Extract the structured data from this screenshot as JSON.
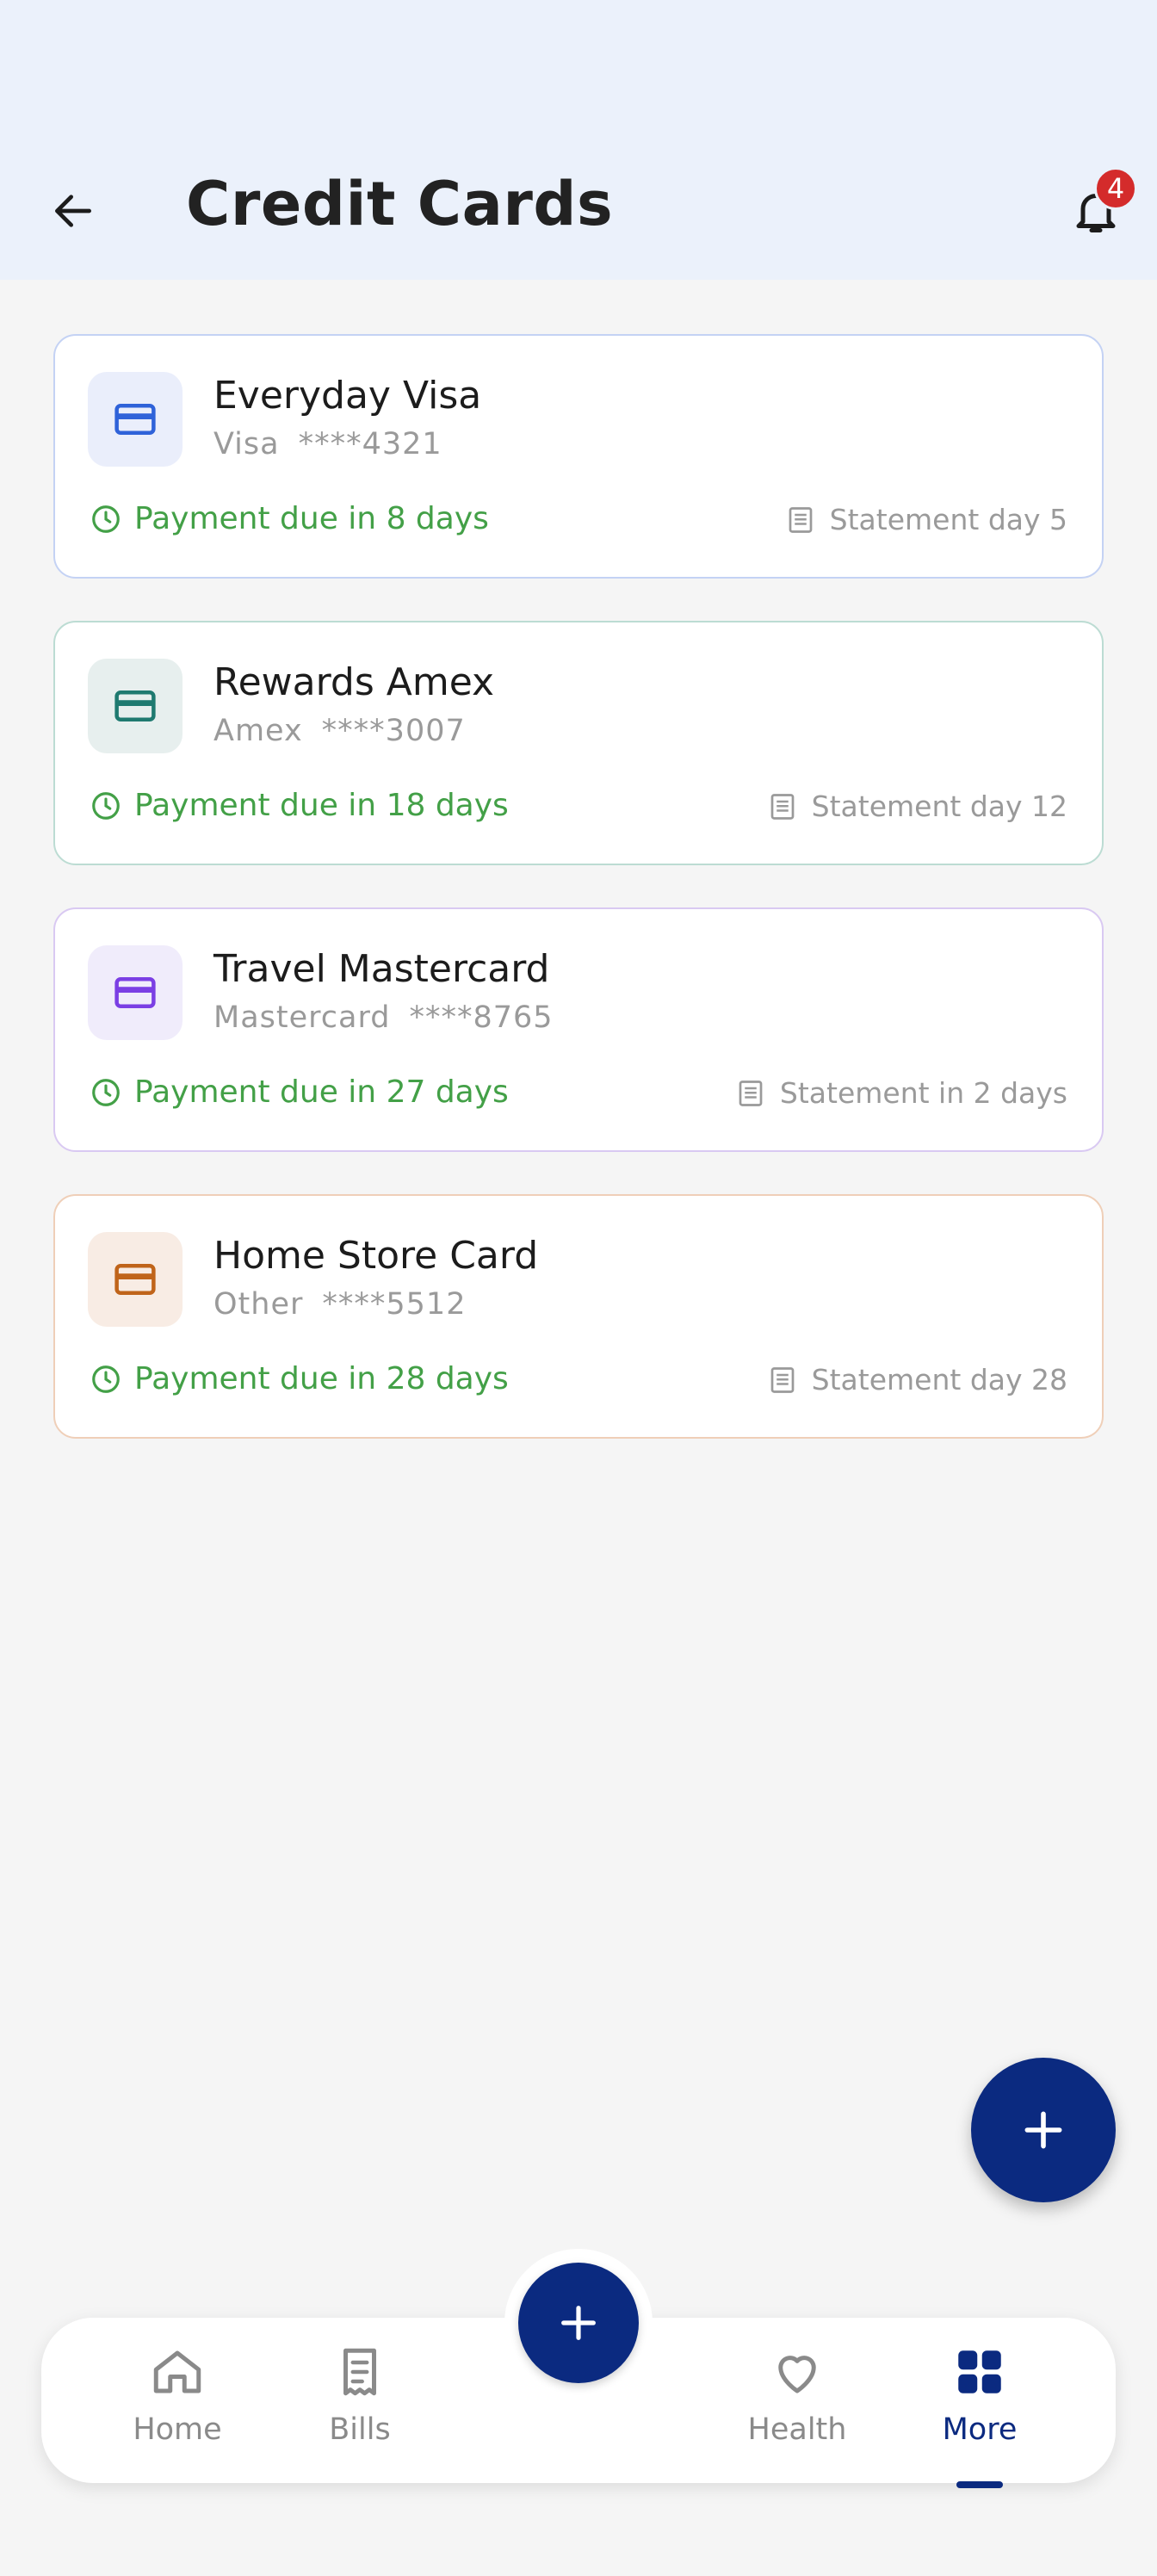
{
  "header": {
    "title": "Credit Cards",
    "notification_count": "4"
  },
  "cards": [
    {
      "name": "Everyday Visa",
      "network": "Visa",
      "number": "****4321",
      "due": "Payment due in 8 days",
      "statement": "Statement day 5",
      "icon": "credit-card-icon",
      "accent": "#2f62d9",
      "icon_bg": "#eaeefb",
      "border": "#c4d2f4"
    },
    {
      "name": "Rewards Amex",
      "network": "Amex",
      "number": "****3007",
      "due": "Payment due in 18 days",
      "statement": "Statement day 12",
      "icon": "credit-card-icon",
      "accent": "#1f7a70",
      "icon_bg": "#e7efee",
      "border": "#bcdcd3"
    },
    {
      "name": "Travel Mastercard",
      "network": "Mastercard",
      "number": "****8765",
      "due": "Payment due in 27 days",
      "statement": "Statement in 2 days",
      "icon": "credit-card-icon",
      "accent": "#7b3fe4",
      "icon_bg": "#f0ecfb",
      "border": "#d9c9f2"
    },
    {
      "name": "Home Store Card",
      "network": "Other",
      "number": "****5512",
      "due": "Payment due in 28 days",
      "statement": "Statement day 28",
      "icon": "credit-card-icon",
      "accent": "#c0641a",
      "icon_bg": "#f8ece4",
      "border": "#efcfb8"
    }
  ],
  "status_color": "#43a047",
  "fab": {
    "icon": "plus-icon"
  },
  "nav": {
    "items": [
      {
        "label": "Home",
        "icon": "home-icon"
      },
      {
        "label": "Bills",
        "icon": "receipt-icon"
      },
      {
        "label": "Health",
        "icon": "heart-icon"
      },
      {
        "label": "More",
        "icon": "grid-icon"
      }
    ],
    "active": "More",
    "center_icon": "plus-icon"
  }
}
